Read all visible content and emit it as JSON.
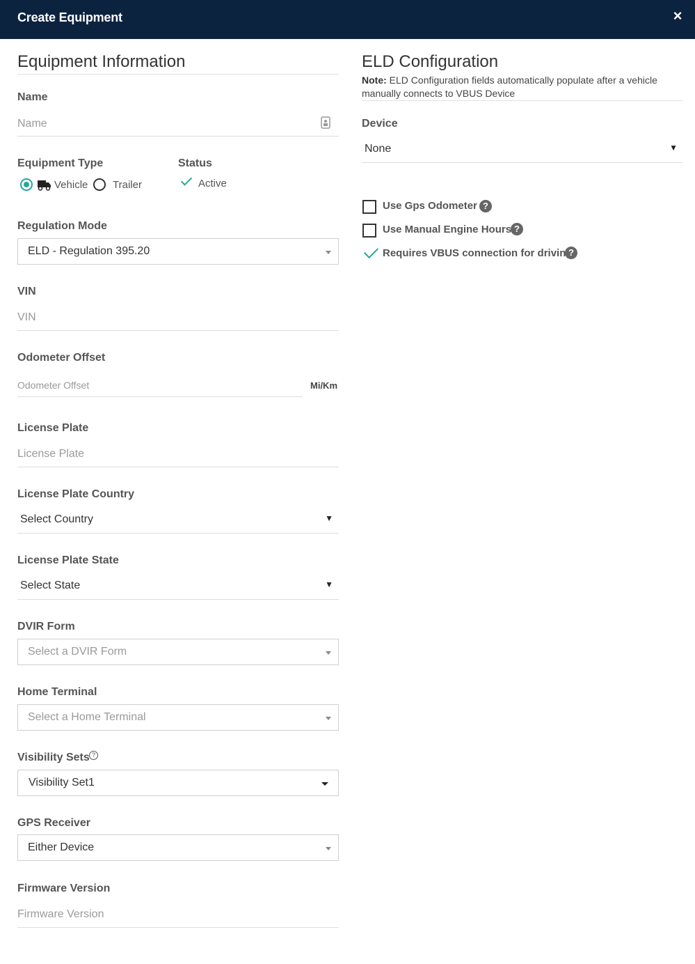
{
  "header": {
    "title": "Create Equipment",
    "close_glyph": "×"
  },
  "equipment_info": {
    "title": "Equipment Information",
    "name": {
      "label": "Name",
      "placeholder": "Name"
    },
    "equipment_type": {
      "label": "Equipment Type",
      "options": [
        {
          "label": "Vehicle",
          "checked": true
        },
        {
          "label": "Trailer",
          "checked": false
        }
      ]
    },
    "status": {
      "label": "Status",
      "value": "Active"
    },
    "regulation_mode": {
      "label": "Regulation Mode",
      "value": "ELD - Regulation 395.20"
    },
    "vin": {
      "label": "VIN",
      "placeholder": "VIN"
    },
    "odometer_offset": {
      "label": "Odometer Offset",
      "placeholder": "Odometer Offset",
      "unit": "Mi/Km"
    },
    "license_plate": {
      "label": "License Plate",
      "placeholder": "License Plate"
    },
    "license_plate_country": {
      "label": "License Plate Country",
      "value": "Select Country"
    },
    "license_plate_state": {
      "label": "License Plate State",
      "value": "Select State"
    },
    "dvir_form": {
      "label": "DVIR Form",
      "value": "Select a DVIR Form"
    },
    "home_terminal": {
      "label": "Home Terminal",
      "value": "Select a Home Terminal"
    },
    "visibility_sets": {
      "label": "Visibility Sets",
      "value": "Visibility Set1"
    },
    "gps_receiver": {
      "label": "GPS Receiver",
      "value": "Either Device"
    },
    "firmware_version": {
      "label": "Firmware Version",
      "placeholder": "Firmware Version"
    }
  },
  "eld_config": {
    "title": "ELD Configuration",
    "note_prefix": "Note:",
    "note_text": "ELD Configuration fields automatically populate after a vehicle manually connects to VBUS Device",
    "device": {
      "label": "Device",
      "value": "None"
    },
    "checkboxes": [
      {
        "label": "Use Gps Odometer",
        "checked": false
      },
      {
        "label": "Use Manual Engine Hours",
        "checked": false
      },
      {
        "label": "Requires VBUS connection for driving",
        "checked": true
      }
    ],
    "help_glyph": "?"
  },
  "colors": {
    "header_bg": "#0c2340",
    "accent": "#26a69a"
  }
}
